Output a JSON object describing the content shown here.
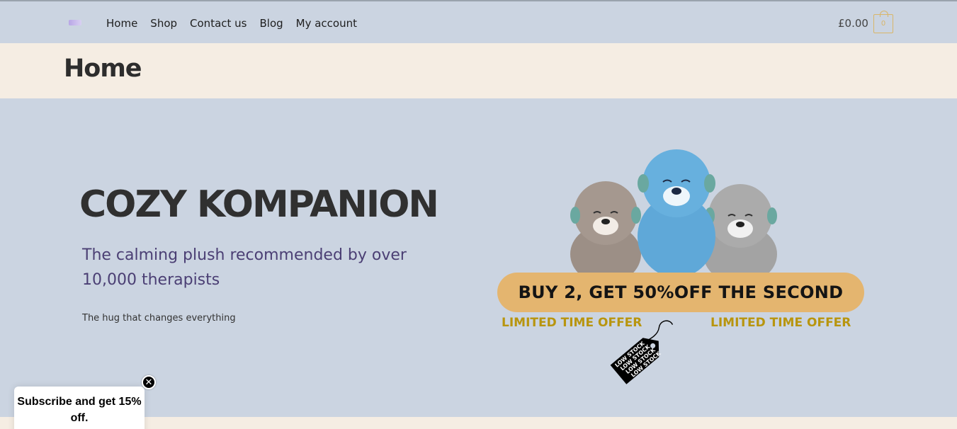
{
  "header": {
    "logo_icon": "logo-icon",
    "nav": [
      {
        "label": "Home"
      },
      {
        "label": "Shop"
      },
      {
        "label": "Contact us"
      },
      {
        "label": "Blog"
      },
      {
        "label": "My account"
      }
    ],
    "cart_total": "£0.00",
    "cart_count": "0",
    "cart_icon": "shopping-bag-icon"
  },
  "page": {
    "title": "Home"
  },
  "hero": {
    "title": "COZY KOMPANION",
    "subtitle": "The calming plush recommended by over 10,000 therapists",
    "tagline": "The hug that changes everything"
  },
  "promo": {
    "offer": "BUY 2, GET 50%OFF THE SECOND",
    "limited_left": "LIMITED TIME OFFER",
    "limited_right": "LIMITED TIME OFFER",
    "tag_lines": [
      "LOW STOCK",
      "LOW STOCK",
      "LOW STOCK",
      "LOW STOCK"
    ]
  },
  "popup": {
    "text": "Subscribe and get 15% off.",
    "close_icon": "close-icon"
  },
  "colors": {
    "background": "#cbd4e1",
    "band": "#f5ede3",
    "accent_gold": "#e4b56f",
    "limited_text": "#b8950e",
    "subtitle": "#4b3f74",
    "otter_blue": "#5fa8d8",
    "otter_brown": "#9c8f86",
    "otter_grey": "#a3a3a3"
  }
}
